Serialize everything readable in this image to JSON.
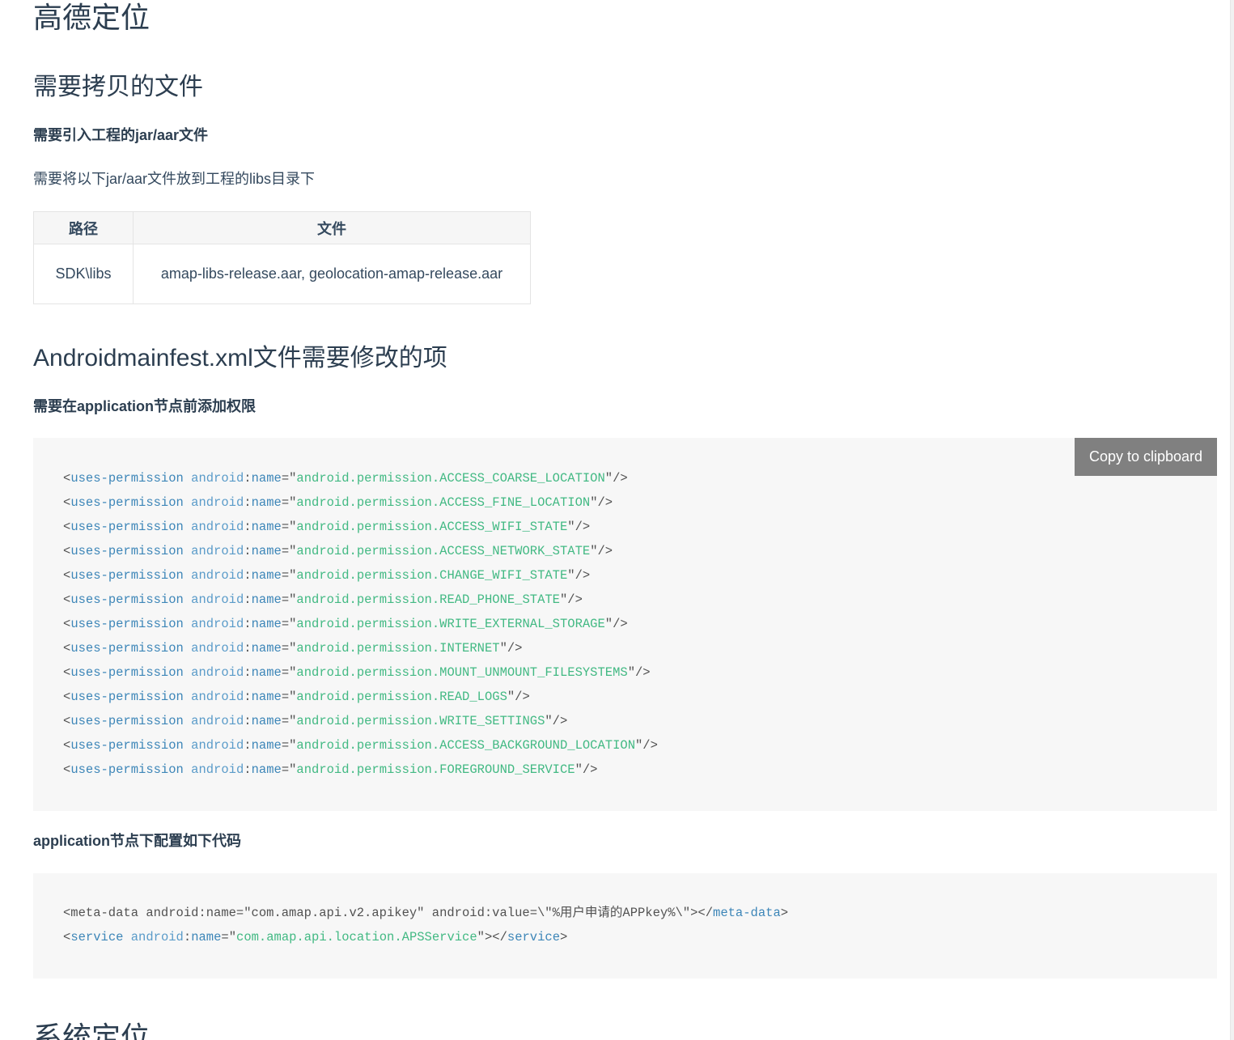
{
  "page": {
    "title": "高德定位",
    "next_title_partial": "系统定位"
  },
  "section_copy": {
    "heading": "需要拷贝的文件",
    "subheading": "需要引入工程的jar/aar文件",
    "paragraph": "需要将以下jar/aar文件放到工程的libs目录下",
    "table": {
      "headers": [
        "路径",
        "文件"
      ],
      "rows": [
        [
          "SDK\\libs",
          "amap-libs-release.aar, geolocation-amap-release.aar"
        ]
      ]
    }
  },
  "section_manifest": {
    "heading": "Androidmainfest.xml文件需要修改的项",
    "permissions_subheading": "需要在application节点前添加权限",
    "copy_button_label": "Copy to clipboard",
    "permission_tag": "uses-permission",
    "permission_attr_ns": "android",
    "permission_attr_name": "name",
    "permissions": [
      "android.permission.ACCESS_COARSE_LOCATION",
      "android.permission.ACCESS_FINE_LOCATION",
      "android.permission.ACCESS_WIFI_STATE",
      "android.permission.ACCESS_NETWORK_STATE",
      "android.permission.CHANGE_WIFI_STATE",
      "android.permission.READ_PHONE_STATE",
      "android.permission.WRITE_EXTERNAL_STORAGE",
      "android.permission.INTERNET",
      "android.permission.MOUNT_UNMOUNT_FILESYSTEMS",
      "android.permission.READ_LOGS",
      "android.permission.WRITE_SETTINGS",
      "android.permission.ACCESS_BACKGROUND_LOCATION",
      "android.permission.FOREGROUND_SERVICE"
    ],
    "application_subheading": "application节点下配置如下代码",
    "app_code_line1_plain": "<meta-data android:name=\"com.amap.api.v2.apikey\" android:value=\\\"%用户申请的APPkey%\\\"></",
    "app_code_line1_tag": "meta-data",
    "app_code_line1_end": ">",
    "app_code_line2_tag": "service",
    "app_code_line2_value": "com.amap.api.location.APSService"
  }
}
